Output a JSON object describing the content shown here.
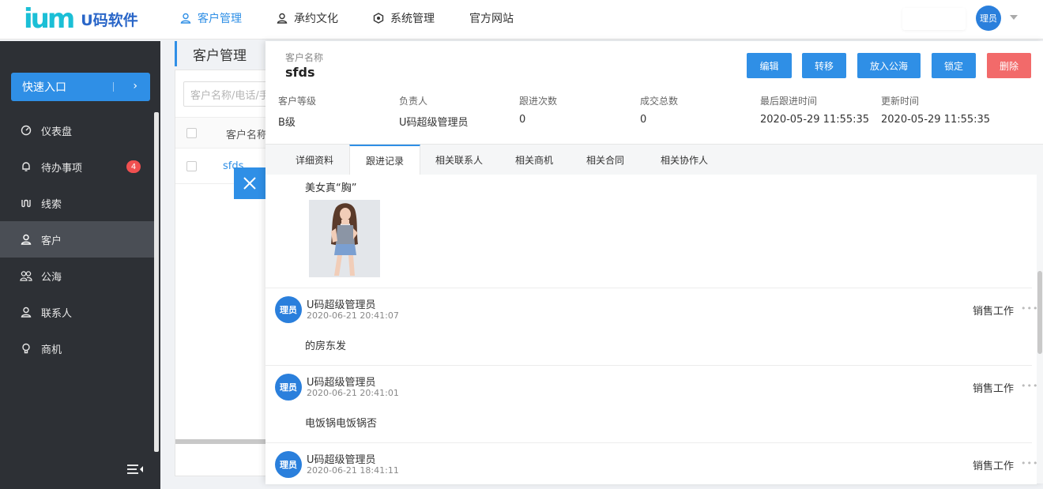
{
  "header": {
    "logo_mark": "ium",
    "logo_text": "U码软件",
    "nav": [
      {
        "label": "客户管理",
        "icon": "user-icon",
        "active": true
      },
      {
        "label": "承约文化",
        "icon": "user-icon",
        "active": false
      },
      {
        "label": "系统管理",
        "icon": "gear-icon",
        "active": false
      },
      {
        "label": "官方网站",
        "icon": "",
        "active": false
      }
    ],
    "avatar_text": "理员"
  },
  "sidebar": {
    "quick_entry": "快速入口",
    "items": [
      {
        "label": "仪表盘",
        "icon": "dashboard-icon"
      },
      {
        "label": "待办事项",
        "icon": "bell-icon",
        "badge": "4"
      },
      {
        "label": "线索",
        "icon": "clue-icon"
      },
      {
        "label": "客户",
        "icon": "user-icon",
        "active": true
      },
      {
        "label": "公海",
        "icon": "users-icon"
      },
      {
        "label": "联系人",
        "icon": "contact-icon"
      },
      {
        "label": "商机",
        "icon": "bulb-icon"
      }
    ]
  },
  "list_page": {
    "title": "客户管理",
    "search_placeholder": "客户名称/电话/手机",
    "column_name": "客户名称",
    "row_name": "sfds"
  },
  "drawer": {
    "name_label": "客户名称",
    "name": "sfds",
    "actions": [
      "编辑",
      "转移",
      "放入公海",
      "锁定",
      "删除"
    ],
    "info": [
      {
        "label": "客户等级",
        "value": "B级"
      },
      {
        "label": "负责人",
        "value": "U码超级管理员"
      },
      {
        "label": "跟进次数",
        "value": "0"
      },
      {
        "label": "成交总数",
        "value": "0"
      },
      {
        "label": "最后跟进时间",
        "value": "2020-05-29 11:55:35"
      },
      {
        "label": "更新时间",
        "value": "2020-05-29 11:55:35"
      }
    ],
    "tabs": [
      "详细资料",
      "跟进记录",
      "相关联系人",
      "相关商机",
      "相关合同",
      "相关协作人"
    ],
    "active_tab": "跟进记录",
    "first_post_text": "美女真“胸”",
    "records": [
      {
        "avatar": "理员",
        "user": "U码超级管理员",
        "time": "2020-06-21 20:41:07",
        "tag": "销售工作",
        "content": "的房东发"
      },
      {
        "avatar": "理员",
        "user": "U码超级管理员",
        "time": "2020-06-21 20:41:01",
        "tag": "销售工作",
        "content": "电饭锅电饭锅否"
      },
      {
        "avatar": "理员",
        "user": "U码超级管理员",
        "time": "2020-06-21 18:41:11",
        "tag": "销售工作",
        "content": ""
      }
    ]
  },
  "colors": {
    "primary": "#2f8fe6",
    "danger": "#f26a6a",
    "sidebar_bg": "#2d3035"
  }
}
